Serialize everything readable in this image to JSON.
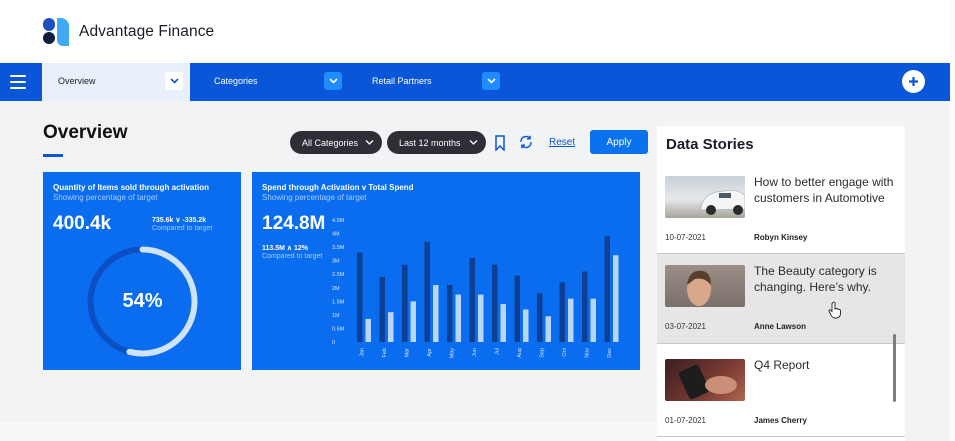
{
  "app": {
    "brand": "Advantage Finance"
  },
  "nav": {
    "tabs": [
      {
        "label": "Overview"
      },
      {
        "label": "Categories"
      },
      {
        "label": "Retail Partners"
      }
    ]
  },
  "main": {
    "title": "Overview",
    "filters": {
      "category": "All Categories",
      "period": "Last 12 months"
    },
    "reset_label": "Reset",
    "apply_label": "Apply"
  },
  "card1": {
    "title": "Quantity of Items sold through activation",
    "subtitle": "Showing percentage of target",
    "value": "400.4k",
    "delta": "735.6k ∨ -335.2k",
    "compared": "Compared to target",
    "percent_label": "54%",
    "percent": 0.54
  },
  "card2": {
    "title": "Spend through Activation v Total Spend",
    "subtitle": "Showing percentage of target",
    "value": "124.8M",
    "delta": "113.5M ∧ 12%",
    "compared": "Compared to target"
  },
  "chart_data": {
    "type": "bar",
    "categories": [
      "Jan",
      "Feb",
      "Mar",
      "Apr",
      "May",
      "Jun",
      "Jul",
      "Aug",
      "Sep",
      "Oct",
      "Nov",
      "Dec"
    ],
    "y_ticks": [
      "0",
      "0.5M",
      "1M",
      "1.5M",
      "2M",
      "2.5M",
      "3M",
      "3.5M",
      "4M",
      "4.5M"
    ],
    "ylim": [
      0,
      4.5
    ],
    "series": [
      {
        "values": [
          3.3,
          2.4,
          2.85,
          3.7,
          2.1,
          3.1,
          2.85,
          2.45,
          1.8,
          2.2,
          2.6,
          3.9
        ]
      },
      {
        "values": [
          0.85,
          1.1,
          1.5,
          2.1,
          1.75,
          1.75,
          1.4,
          1.2,
          0.95,
          1.6,
          1.6,
          3.2
        ]
      }
    ],
    "colors": [
      "#0d3f94",
      "#b9d6f7"
    ]
  },
  "stories": {
    "title": "Data Stories",
    "items": [
      {
        "headline": "How to better engage with customers in Automotive",
        "date": "10-07-2021",
        "author": "Robyn Kinsey"
      },
      {
        "headline": "The Beauty category is changing. Here’s why.",
        "date": "03-07-2021",
        "author": "Anne Lawson"
      },
      {
        "headline": "Q4 Report",
        "date": "01-07-2021",
        "author": "James Cherry"
      }
    ]
  },
  "colors": {
    "primary": "#0a56d8",
    "card": "#0a6df0",
    "dark_pill": "#2e2f36"
  }
}
